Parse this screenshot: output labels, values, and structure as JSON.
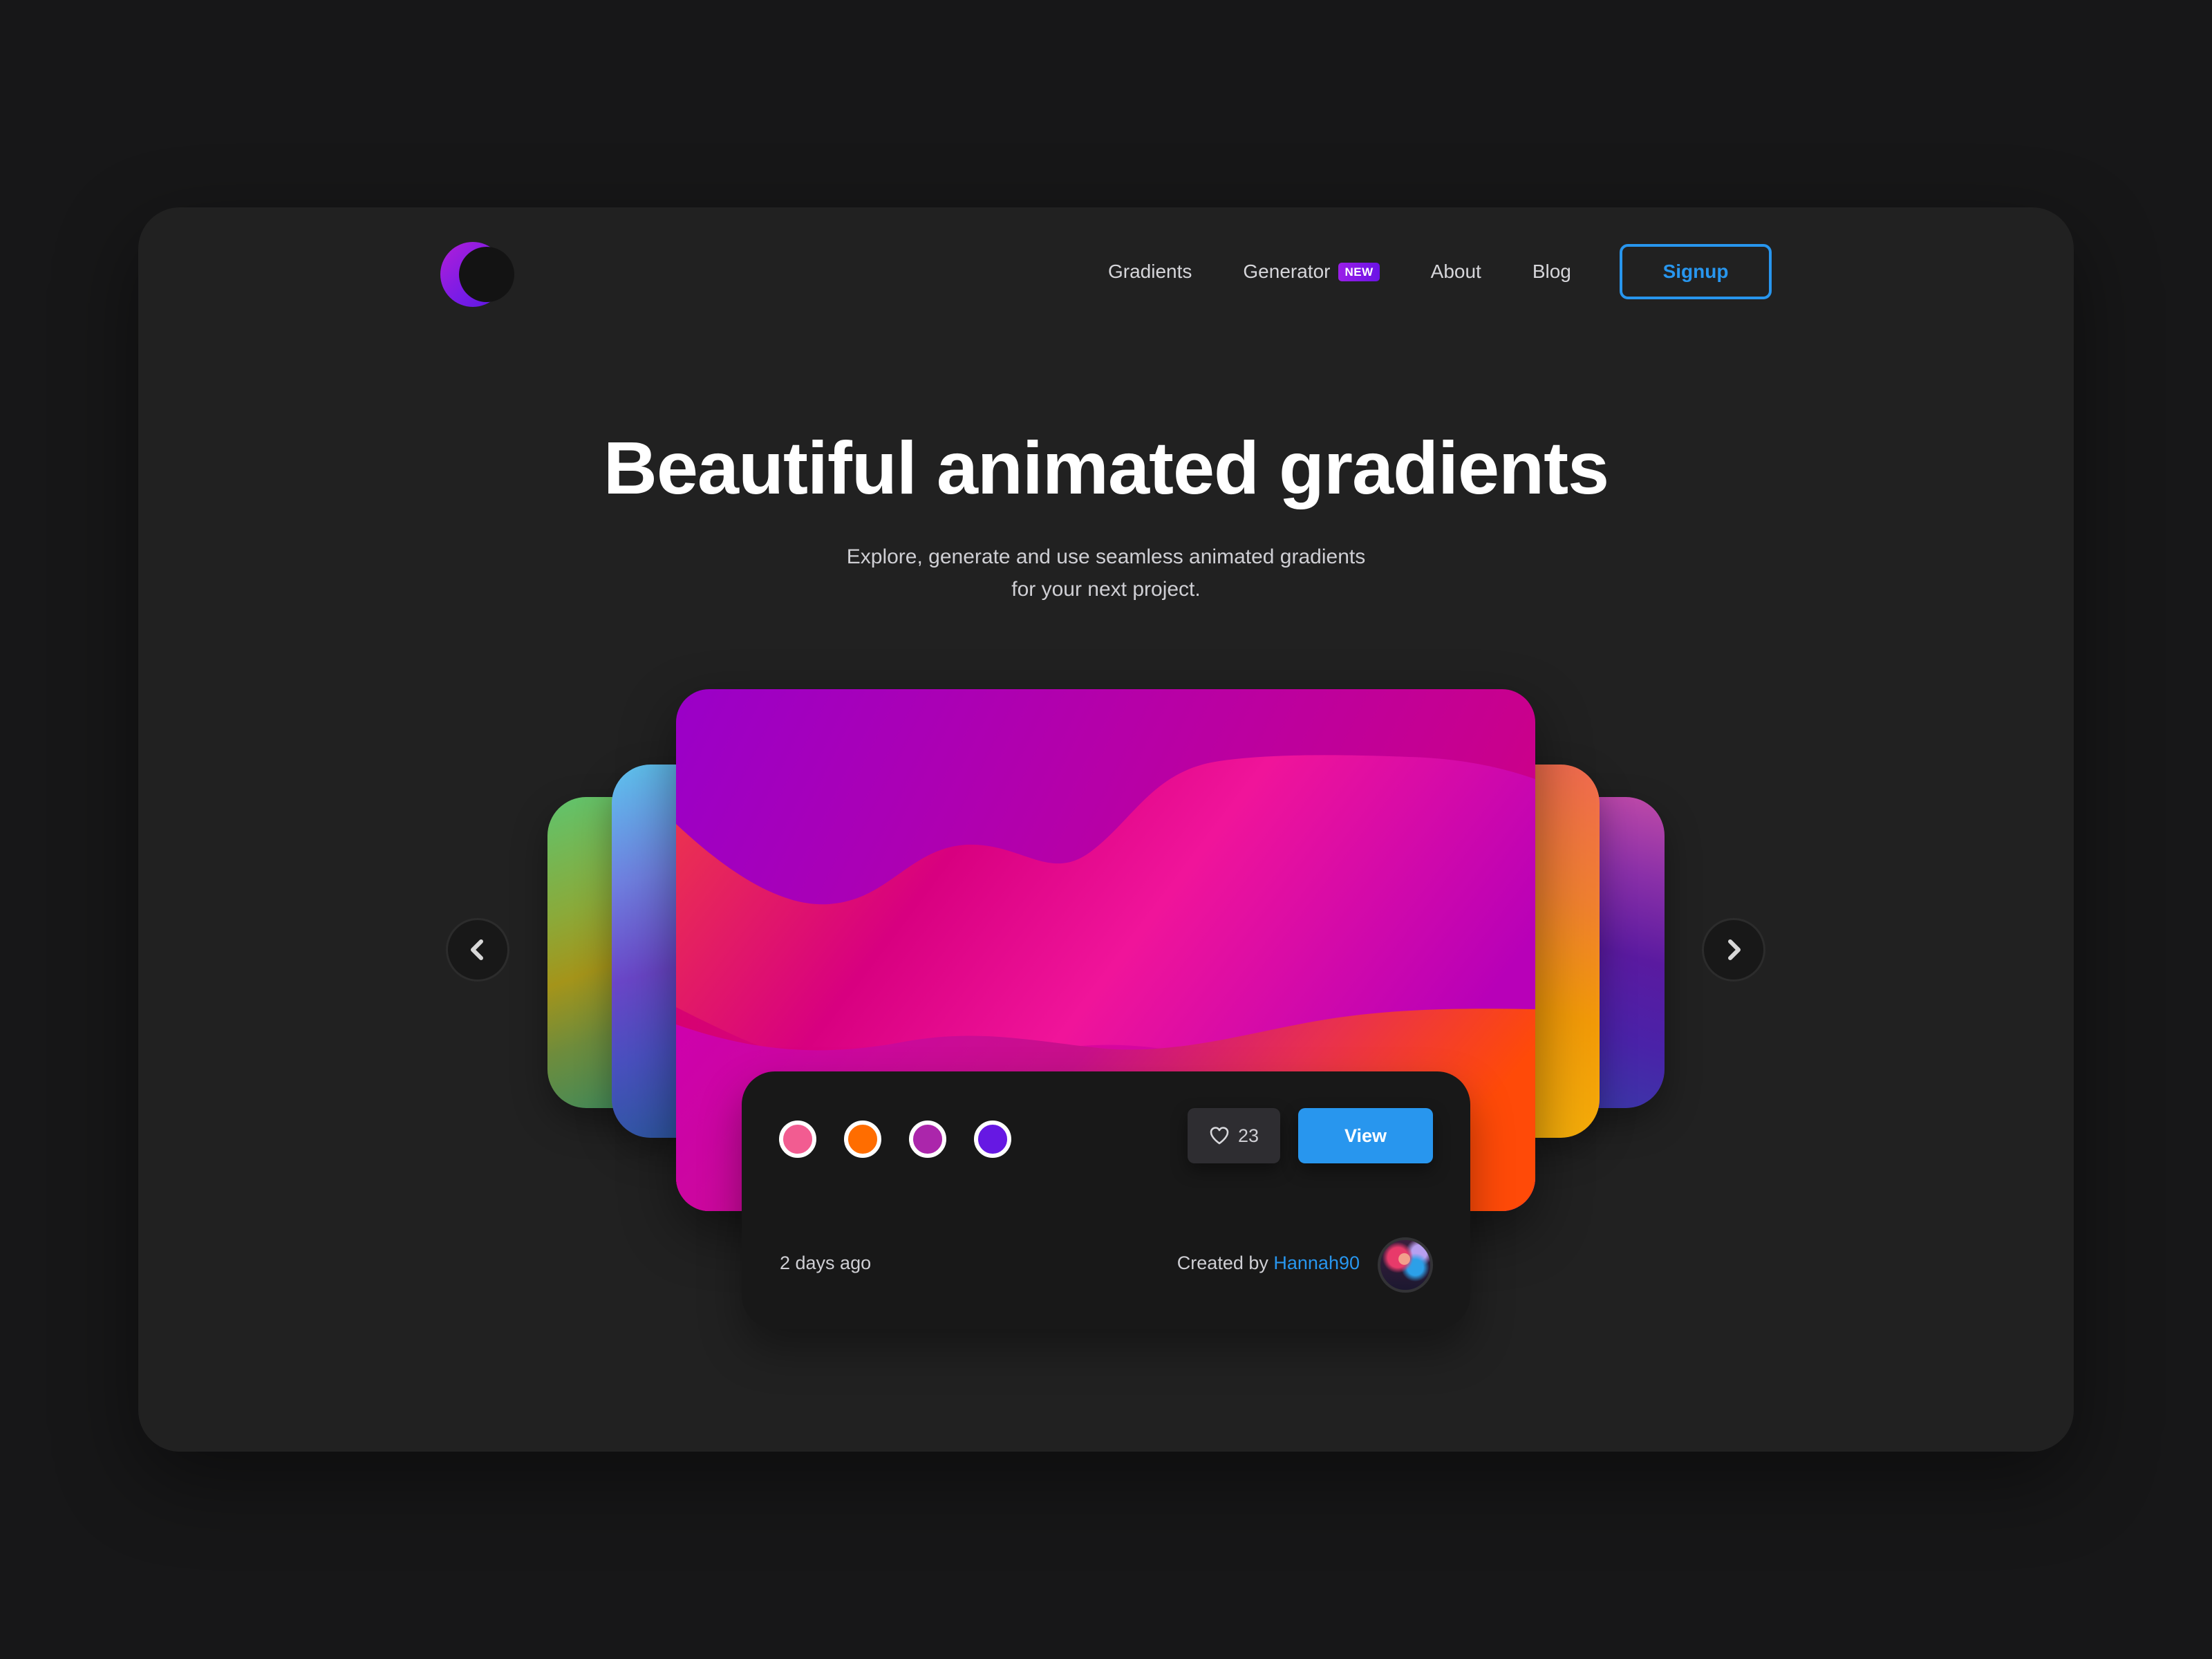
{
  "brand": {
    "logo_icon": "crescent-moon-logo",
    "accent_color": "#2896EE",
    "brand_purple": "#7A1CE6"
  },
  "nav": {
    "items": [
      {
        "label": "Gradients"
      },
      {
        "label": "Generator",
        "badge": "NEW"
      },
      {
        "label": "About"
      },
      {
        "label": "Blog"
      }
    ],
    "signup_label": "Signup"
  },
  "hero": {
    "title": "Beautiful animated gradients",
    "subtitle_line1": "Explore, generate and use seamless animated gradients",
    "subtitle_line2": "for your next project."
  },
  "carousel": {
    "prev_icon": "chevron-left-icon",
    "next_icon": "chevron-right-icon",
    "featured": {
      "palette": [
        {
          "color": "#F25C91"
        },
        {
          "color": "#FF6D00"
        },
        {
          "color": "#AB26AB"
        },
        {
          "color": "#6618E3"
        }
      ],
      "likes": "23",
      "like_icon": "heart-icon",
      "view_label": "View",
      "timestamp": "2 days ago",
      "created_by_prefix": "Created by",
      "creator": "Hannah90"
    }
  }
}
